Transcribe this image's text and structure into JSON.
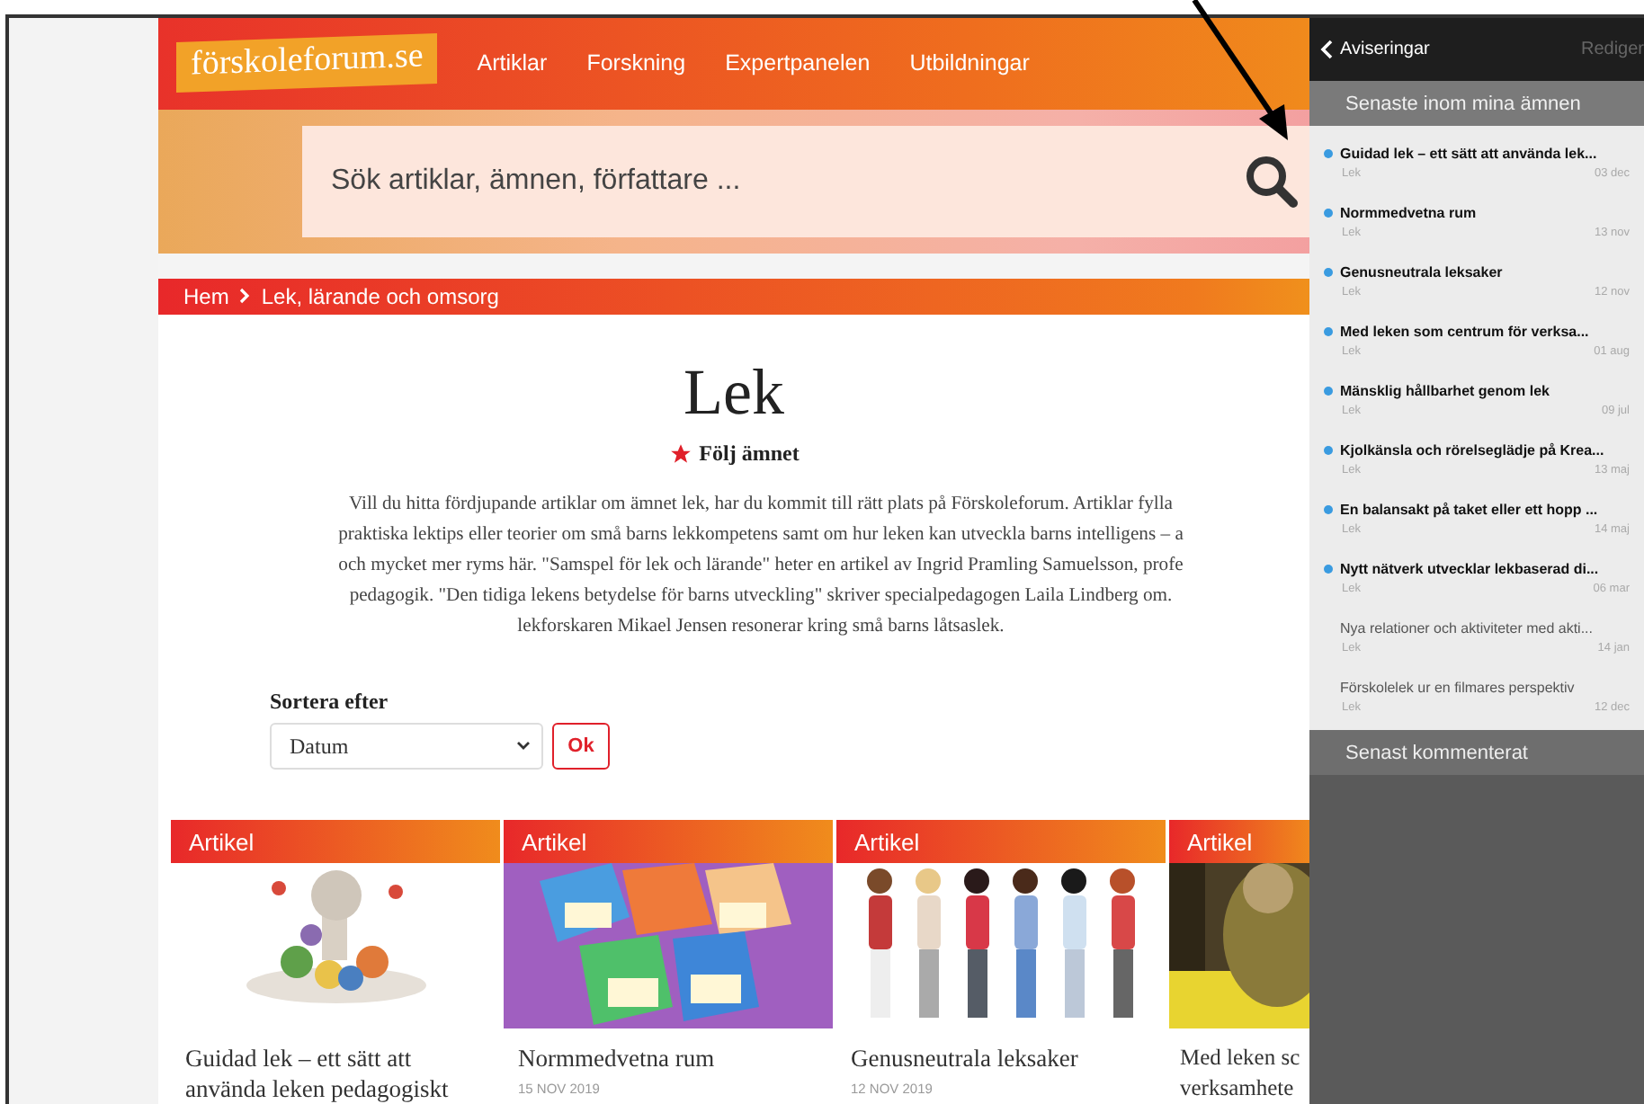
{
  "site": {
    "logo": "förskoleforum.se",
    "nav": [
      {
        "label": "Artiklar"
      },
      {
        "label": "Forskning"
      },
      {
        "label": "Expertpanelen"
      },
      {
        "label": "Utbildningar"
      }
    ]
  },
  "search": {
    "placeholder": "Sök artiklar, ämnen, författare ..."
  },
  "breadcrumb": [
    "Hem",
    "Lek, lärande och omsorg"
  ],
  "topic": {
    "title": "Lek",
    "follow": "Följ ämnet",
    "intro": "Vill du hitta fördjupande artiklar om ämnet lek, har du kommit till rätt plats på Förskoleforum. Artiklar fylla\npraktiska lektips eller teorier om små barns lekkompetens samt om hur leken kan utveckla barns intelligens – a\noch mycket mer ryms här. \"Samspel för lek och lärande\" heter en artikel av Ingrid Pramling Samuelsson, profe\npedagogik. \"Den tidiga lekens betydelse för barns utveckling\" skriver specialpedagogen Laila Lindberg om.\nlekforskaren Mikael Jensen resonerar kring små barns låtsaslek."
  },
  "sort": {
    "label": "Sortera efter",
    "value": "Datum",
    "button": "Ok"
  },
  "cards": [
    {
      "tag": "Artikel",
      "title": "Guidad lek – ett sätt att använda leken pedagogiskt"
    },
    {
      "tag": "Artikel",
      "title": "Normmedvetna rum",
      "date": "15 NOV 2019"
    },
    {
      "tag": "Artikel",
      "title": "Genusneutrala leksaker",
      "date": "12 NOV 2019"
    },
    {
      "tag": "Artikel",
      "title": "Med leken sc verksamhete"
    }
  ],
  "notifications": {
    "back": "Aviseringar",
    "edit": "Rediger",
    "section": "Senaste inom mina ämnen",
    "items": [
      {
        "title": "Guidad lek – ett sätt att använda lek...",
        "topic": "Lek",
        "date": "03 dec",
        "unread": true
      },
      {
        "title": "Normmedvetna rum",
        "topic": "Lek",
        "date": "13 nov",
        "unread": true
      },
      {
        "title": "Genusneutrala leksaker",
        "topic": "Lek",
        "date": "12 nov",
        "unread": true
      },
      {
        "title": "Med leken som centrum för verksa...",
        "topic": "Lek",
        "date": "01 aug",
        "unread": true
      },
      {
        "title": "Mänsklig hållbarhet genom lek",
        "topic": "Lek",
        "date": "09 jul",
        "unread": true
      },
      {
        "title": "Kjolkänsla och rörelseglädje på Krea...",
        "topic": "Lek",
        "date": "13 maj",
        "unread": true
      },
      {
        "title": "En balansakt på taket eller ett hopp ...",
        "topic": "Lek",
        "date": "14 maj",
        "unread": true
      },
      {
        "title": "Nytt nätverk utvecklar lekbaserad di...",
        "topic": "Lek",
        "date": "06 mar",
        "unread": true
      },
      {
        "title": "Nya relationer och aktiviteter med akti...",
        "topic": "Lek",
        "date": "14 jan",
        "unread": false
      },
      {
        "title": "Förskolelek ur en filmares perspektiv",
        "topic": "Lek",
        "date": "12 dec",
        "unread": false
      }
    ],
    "section2": "Senast kommenterat"
  }
}
